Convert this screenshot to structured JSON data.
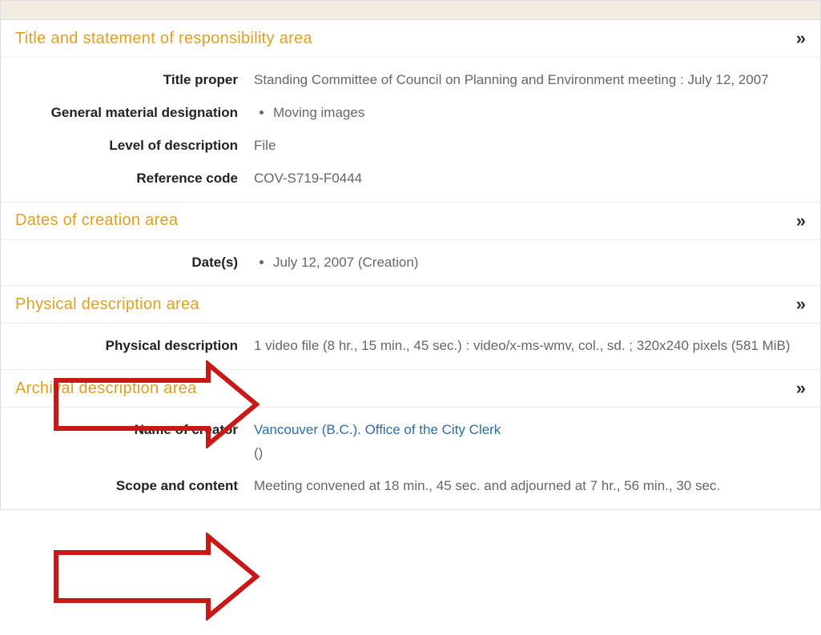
{
  "sections": {
    "title_area": {
      "header": "Title and statement of responsibility area",
      "fields": {
        "title_proper": {
          "label": "Title proper",
          "value": "Standing Committee of Council on Planning and Environment meeting : July 12, 2007"
        },
        "gmd": {
          "label": "General material designation",
          "items": [
            "Moving images"
          ]
        },
        "level": {
          "label": "Level of description",
          "value": "File"
        },
        "refcode": {
          "label": "Reference code",
          "value": "COV-S719-F0444"
        }
      }
    },
    "dates_area": {
      "header": "Dates of creation area",
      "fields": {
        "dates": {
          "label": "Date(s)",
          "items": [
            "July 12, 2007 (Creation)"
          ]
        }
      }
    },
    "physical_area": {
      "header": "Physical description area",
      "fields": {
        "physdesc": {
          "label": "Physical description",
          "value": "1 video file (8 hr., 15 min., 45 sec.) : video/x-ms-wmv, col., sd. ; 320x240 pixels (581 MiB)"
        }
      }
    },
    "archival_area": {
      "header": "Archival description area",
      "fields": {
        "creator": {
          "label": "Name of creator",
          "link": "Vancouver (B.C.). Office of the City Clerk",
          "suffix": "()"
        },
        "scope": {
          "label": "Scope and content",
          "value": "Meeting convened at 18 min., 45 sec. and adjourned at 7 hr., 56 min., 30 sec."
        }
      }
    }
  },
  "expand_glyph": "»"
}
